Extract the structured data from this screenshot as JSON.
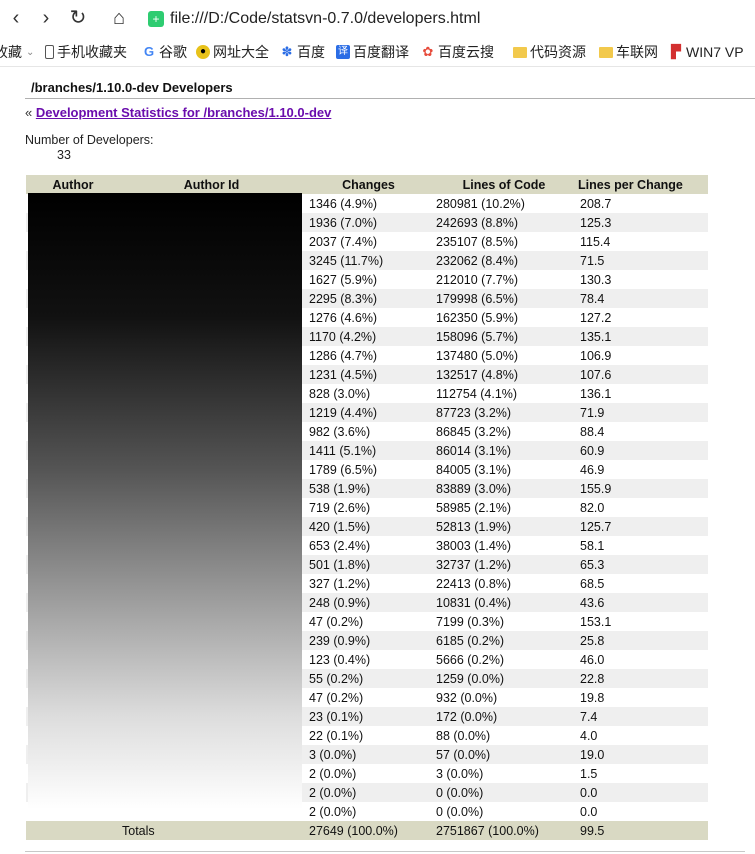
{
  "browser": {
    "url": "file:///D:/Code/statsvn-0.7.0/developers.html",
    "bookmarks": [
      {
        "label": "收藏",
        "icon": "chevron-icon"
      },
      {
        "label": "手机收藏夹",
        "icon": "phone-icon"
      },
      {
        "label": "谷歌",
        "icon": "google-icon"
      },
      {
        "label": "网址大全",
        "icon": "sites-icon"
      },
      {
        "label": "百度",
        "icon": "baidu-icon"
      },
      {
        "label": "百度翻译",
        "icon": "translate-icon"
      },
      {
        "label": "百度云搜",
        "icon": "cloud-icon"
      },
      {
        "label": "代码资源",
        "icon": "folder-icon"
      },
      {
        "label": "车联网",
        "icon": "folder-icon"
      },
      {
        "label": "WIN7 VP",
        "icon": "flag-icon"
      }
    ]
  },
  "page": {
    "title": "/branches/1.10.0-dev Developers",
    "back_prefix": "«",
    "back_link": "Development Statistics for /branches/1.10.0-dev",
    "dev_label": "Number of Developers:",
    "dev_count": "33"
  },
  "table": {
    "headers": [
      "Author",
      "Author Id",
      "Changes",
      "Lines of Code",
      "Lines per Change"
    ],
    "rows": [
      [
        "1346 (4.9%)",
        "280981 (10.2%)",
        "208.7"
      ],
      [
        "1936 (7.0%)",
        "242693 (8.8%)",
        "125.3"
      ],
      [
        "2037 (7.4%)",
        "235107 (8.5%)",
        "115.4"
      ],
      [
        "3245 (11.7%)",
        "232062 (8.4%)",
        "71.5"
      ],
      [
        "1627 (5.9%)",
        "212010 (7.7%)",
        "130.3"
      ],
      [
        "2295 (8.3%)",
        "179998 (6.5%)",
        "78.4"
      ],
      [
        "1276 (4.6%)",
        "162350 (5.9%)",
        "127.2"
      ],
      [
        "1170 (4.2%)",
        "158096 (5.7%)",
        "135.1"
      ],
      [
        "1286 (4.7%)",
        "137480 (5.0%)",
        "106.9"
      ],
      [
        "1231 (4.5%)",
        "132517 (4.8%)",
        "107.6"
      ],
      [
        "828 (3.0%)",
        "112754 (4.1%)",
        "136.1"
      ],
      [
        "1219 (4.4%)",
        "87723 (3.2%)",
        "71.9"
      ],
      [
        "982 (3.6%)",
        "86845 (3.2%)",
        "88.4"
      ],
      [
        "1411 (5.1%)",
        "86014 (3.1%)",
        "60.9"
      ],
      [
        "1789 (6.5%)",
        "84005 (3.1%)",
        "46.9"
      ],
      [
        "538 (1.9%)",
        "83889 (3.0%)",
        "155.9"
      ],
      [
        "719 (2.6%)",
        "58985 (2.1%)",
        "82.0"
      ],
      [
        "420 (1.5%)",
        "52813 (1.9%)",
        "125.7"
      ],
      [
        "653 (2.4%)",
        "38003 (1.4%)",
        "58.1"
      ],
      [
        "501 (1.8%)",
        "32737 (1.2%)",
        "65.3"
      ],
      [
        "327 (1.2%)",
        "22413 (0.8%)",
        "68.5"
      ],
      [
        "248 (0.9%)",
        "10831 (0.4%)",
        "43.6"
      ],
      [
        "47 (0.2%)",
        "7199 (0.3%)",
        "153.1"
      ],
      [
        "239 (0.9%)",
        "6185 (0.2%)",
        "25.8"
      ],
      [
        "123 (0.4%)",
        "5666 (0.2%)",
        "46.0"
      ],
      [
        "55 (0.2%)",
        "1259 (0.0%)",
        "22.8"
      ],
      [
        "47 (0.2%)",
        "932 (0.0%)",
        "19.8"
      ],
      [
        "23 (0.1%)",
        "172 (0.0%)",
        "7.4"
      ],
      [
        "22 (0.1%)",
        "88 (0.0%)",
        "4.0"
      ],
      [
        "3 (0.0%)",
        "57 (0.0%)",
        "19.0"
      ],
      [
        "2 (0.0%)",
        "3 (0.0%)",
        "1.5"
      ],
      [
        "2 (0.0%)",
        "0 (0.0%)",
        "0.0"
      ],
      [
        "2 (0.0%)",
        "0 (0.0%)",
        "0.0"
      ]
    ],
    "totals": [
      "Totals",
      "27649 (100.0%)",
      "2751867 (100.0%)",
      "99.5"
    ]
  }
}
